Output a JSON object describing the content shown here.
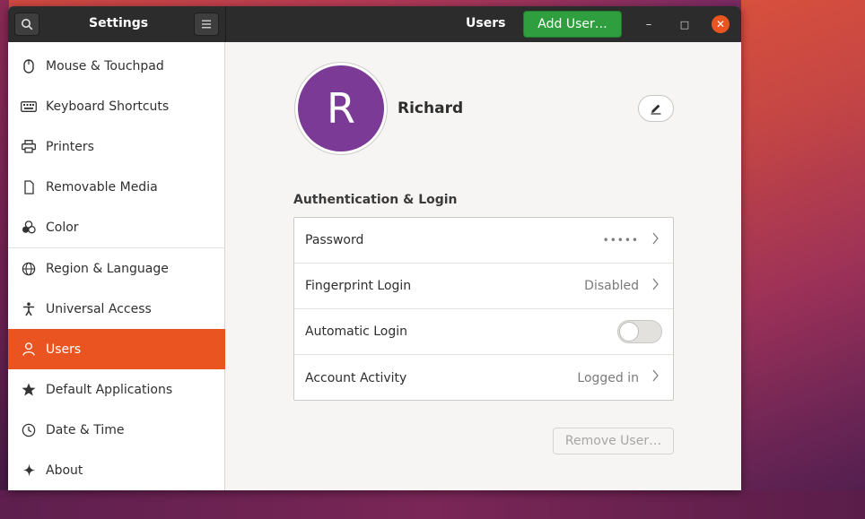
{
  "titlebar": {
    "app_title": "Settings",
    "page_title": "Users",
    "add_user_label": "Add User…",
    "minimize_glyph": "–",
    "maximize_glyph": "□",
    "close_glyph": "✕"
  },
  "sidebar": {
    "items": [
      {
        "label": "Mouse & Touchpad",
        "icon": "mouse-icon"
      },
      {
        "label": "Keyboard Shortcuts",
        "icon": "keyboard-icon"
      },
      {
        "label": "Printers",
        "icon": "printer-icon"
      },
      {
        "label": "Removable Media",
        "icon": "removable-media-icon"
      },
      {
        "label": "Color",
        "icon": "color-icon"
      },
      {
        "label": "Region & Language",
        "icon": "globe-icon"
      },
      {
        "label": "Universal Access",
        "icon": "accessibility-icon"
      },
      {
        "label": "Users",
        "icon": "user-icon",
        "active": true
      },
      {
        "label": "Default Applications",
        "icon": "star-icon"
      },
      {
        "label": "Date & Time",
        "icon": "clock-icon"
      },
      {
        "label": "About",
        "icon": "sparkle-icon"
      }
    ]
  },
  "user": {
    "initial": "R",
    "name": "Richard",
    "avatar_color": "#7b3a96"
  },
  "auth": {
    "section_title": "Authentication & Login",
    "rows": [
      {
        "label": "Password",
        "value": "•••••"
      },
      {
        "label": "Fingerprint Login",
        "value": "Disabled"
      },
      {
        "label": "Automatic Login",
        "toggle": false
      },
      {
        "label": "Account Activity",
        "value": "Logged in"
      }
    ]
  },
  "remove_user_label": "Remove User…",
  "colors": {
    "accent": "#e95420",
    "add_button": "#2f9e3e"
  }
}
